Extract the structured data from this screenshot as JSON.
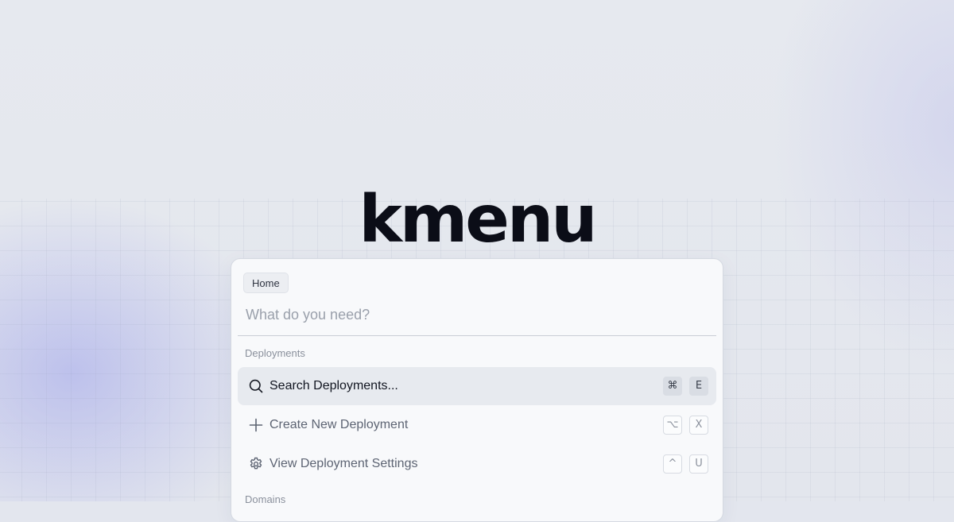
{
  "brand": {
    "title": "kmenu"
  },
  "palette": {
    "breadcrumb": "Home",
    "search_placeholder": "What do you need?",
    "search_value": "",
    "groups": [
      {
        "label": "Deployments",
        "items": [
          {
            "label": "Search Deployments...",
            "icon": "search-icon",
            "shortcut": [
              "⌘",
              "E"
            ],
            "active": true
          },
          {
            "label": "Create New Deployment",
            "icon": "plus-icon",
            "shortcut": [
              "⌥",
              "X"
            ],
            "active": false
          },
          {
            "label": "View Deployment Settings",
            "icon": "gear-icon",
            "shortcut": [
              "^",
              "U"
            ],
            "active": false
          }
        ]
      },
      {
        "label": "Domains",
        "items": []
      }
    ]
  },
  "colors": {
    "brand_text": "#0b0d17",
    "active_row": "#e7eaef",
    "background": "#e3e6ee"
  }
}
